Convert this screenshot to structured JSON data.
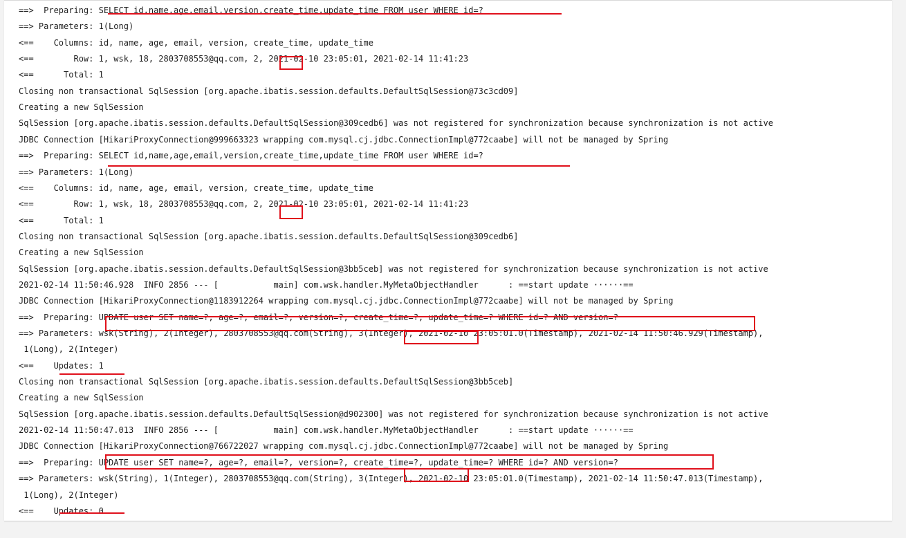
{
  "console": {
    "lines": [
      "==>  Preparing: SELECT id,name,age,email,version,create_time,update_time FROM user WHERE id=?",
      "==> Parameters: 1(Long)",
      "<==    Columns: id, name, age, email, version, create_time, update_time",
      "<==        Row: 1, wsk, 18, 2803708553@qq.com, 2, 2021-02-10 23:05:01, 2021-02-14 11:41:23",
      "<==      Total: 1",
      "Closing non transactional SqlSession [org.apache.ibatis.session.defaults.DefaultSqlSession@73c3cd09]",
      "Creating a new SqlSession",
      "SqlSession [org.apache.ibatis.session.defaults.DefaultSqlSession@309cedb6] was not registered for synchronization because synchronization is not active",
      "JDBC Connection [HikariProxyConnection@999663323 wrapping com.mysql.cj.jdbc.ConnectionImpl@772caabe] will not be managed by Spring",
      "==>  Preparing: SELECT id,name,age,email,version,create_time,update_time FROM user WHERE id=?",
      "==> Parameters: 1(Long)",
      "<==    Columns: id, name, age, email, version, create_time, update_time",
      "<==        Row: 1, wsk, 18, 2803708553@qq.com, 2, 2021-02-10 23:05:01, 2021-02-14 11:41:23",
      "<==      Total: 1",
      "Closing non transactional SqlSession [org.apache.ibatis.session.defaults.DefaultSqlSession@309cedb6]",
      "Creating a new SqlSession",
      "SqlSession [org.apache.ibatis.session.defaults.DefaultSqlSession@3bb5ceb] was not registered for synchronization because synchronization is not active",
      "2021-02-14 11:50:46.928  INFO 2856 --- [           main] com.wsk.handler.MyMetaObjectHandler      : ==start update ······==",
      "JDBC Connection [HikariProxyConnection@1183912264 wrapping com.mysql.cj.jdbc.ConnectionImpl@772caabe] will not be managed by Spring",
      "==>  Preparing: UPDATE user SET name=?, age=?, email=?, version=?, create_time=?, update_time=? WHERE id=? AND version=?",
      "==> Parameters: wsk(String), 2(Integer), 2803708553@qq.com(String), 3(Integer), 2021-02-10 23:05:01.0(Timestamp), 2021-02-14 11:50:46.929(Timestamp),",
      " 1(Long), 2(Integer)",
      "<==    Updates: 1",
      "Closing non transactional SqlSession [org.apache.ibatis.session.defaults.DefaultSqlSession@3bb5ceb]",
      "Creating a new SqlSession",
      "SqlSession [org.apache.ibatis.session.defaults.DefaultSqlSession@d902300] was not registered for synchronization because synchronization is not active",
      "2021-02-14 11:50:47.013  INFO 2856 --- [           main] com.wsk.handler.MyMetaObjectHandler      : ==start update ······==",
      "JDBC Connection [HikariProxyConnection@766722027 wrapping com.mysql.cj.jdbc.ConnectionImpl@772caabe] will not be managed by Spring",
      "==>  Preparing: UPDATE user SET name=?, age=?, email=?, version=?, create_time=?, update_time=? WHERE id=? AND version=?",
      "==> Parameters: wsk(String), 1(Integer), 2803708553@qq.com(String), 3(Integer), 2021-02-10 23:05:01.0(Timestamp), 2021-02-14 11:50:47.013(Timestamp),",
      " 1(Long), 2(Integer)",
      "<==    Updates: 0"
    ]
  },
  "colors": {
    "annotation": "#e0101b",
    "text": "#1f1f1f",
    "background": "#ffffff"
  }
}
